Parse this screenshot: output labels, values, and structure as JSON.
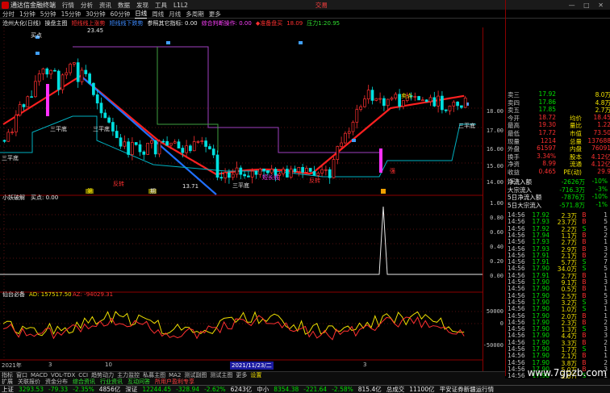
{
  "menubar": {
    "app_title": "通达信金融终端",
    "items": [
      "行情",
      "分析",
      "资讯",
      "数据",
      "发现",
      "工具",
      "L1L2",
      "交易"
    ],
    "brand": "交易"
  },
  "periods": [
    "分时",
    "1分钟",
    "5分钟",
    "15分钟",
    "30分钟",
    "60分钟",
    "日线",
    "周线",
    "月线",
    "多周期",
    "更多"
  ],
  "active_period": "日线",
  "legend": {
    "stock": "沧州大化(日线)",
    "indicator": "操盘主图",
    "up_line": "短线线上涨势",
    "down_line": "短线线下跌势",
    "ref": "参照其它指标: 0.00",
    "plan": "综合判断操作: 0.00",
    "rpt": "◆准备盘买",
    "rpt_val": "18.09",
    "pressure": "压力1:20.95"
  },
  "chart_labels": {
    "high": "23.45",
    "low": "13.71",
    "buy_point": "买点",
    "sell_point": "卖点",
    "three_seller": "三卖点",
    "three_buyer": "三买点",
    "three_point": "三平底",
    "short_long": "短长线",
    "reverse": "反转",
    "strong": "强",
    "a": "第",
    "b": "期"
  },
  "sub1": {
    "name": "小妖破解",
    "label": "买点: 0.00",
    "axis": [
      "1.00",
      "0.80",
      "0.60",
      "0.40",
      "0.20",
      "0.00"
    ]
  },
  "sub2": {
    "name": "仙台必备",
    "ad_label": "AD: 157517.50",
    "az_label": "AZ: -94029.31",
    "axis": [
      "50000",
      "0",
      "-50000"
    ]
  },
  "right_axis": [
    "18.00",
    "17.00",
    "16.00",
    "15.00",
    "14.00"
  ],
  "time_axis": [
    "2021年",
    "3",
    "10",
    "2021/11/23/二",
    "3"
  ],
  "quote_panel": {
    "rows": [
      {
        "k": "卖三",
        "p": "17.92",
        "v": "",
        "x": "8.0万"
      },
      {
        "k": "卖四",
        "p": "17.86",
        "v": "",
        "x": "4.8万"
      },
      {
        "k": "卖五",
        "p": "17.85",
        "v": "",
        "x": "2.7万"
      },
      {
        "k": "今开",
        "p": "18.72",
        "v": "均价",
        "x": "18.45"
      },
      {
        "k": "最高",
        "p": "19.30",
        "v": "量比",
        "x": "1.22"
      },
      {
        "k": "最低",
        "p": "17.72",
        "v": "市值",
        "x": "73.50"
      },
      {
        "k": "现量",
        "p": "1214",
        "v": "总量",
        "x": "137688"
      },
      {
        "k": "外盘",
        "p": "61597",
        "v": "内盘",
        "x": "76091"
      },
      {
        "k": "换手",
        "p": "3.34%",
        "v": "股本",
        "x": "4.12亿"
      },
      {
        "k": "净资",
        "p": "8.99",
        "v": "流通",
        "x": "4.12亿"
      },
      {
        "k": "收益(三)",
        "p": "0.465",
        "v": "PE(动)",
        "x": "29.9"
      }
    ],
    "flow": [
      {
        "k": "净流入额",
        "v": "-2626万",
        "p": "-10%"
      },
      {
        "k": "大宗流入",
        "v": "-716.3万",
        "p": "-3%"
      },
      {
        "k": "5日净流入额",
        "v": "-7876万",
        "p": "-10%"
      },
      {
        "k": "5日大宗流入",
        "v": "-571.8万",
        "p": "-1%"
      }
    ],
    "ticks": [
      {
        "t": "14:56",
        "p": "17.92",
        "v": "2.3万",
        "d": "B",
        "n": "1"
      },
      {
        "t": "14:56",
        "p": "17.93",
        "v": "23.7万",
        "d": "B",
        "n": "5"
      },
      {
        "t": "14:56",
        "p": "17.92",
        "v": "2.2万",
        "d": "S",
        "n": "5"
      },
      {
        "t": "14:56",
        "p": "17.94",
        "v": "1.1万",
        "d": "B",
        "n": "2"
      },
      {
        "t": "14:56",
        "p": "17.93",
        "v": "2.7万",
        "d": "B",
        "n": "1"
      },
      {
        "t": "14:56",
        "p": "17.93",
        "v": "2.9万",
        "d": "B",
        "n": "3"
      },
      {
        "t": "14:56",
        "p": "17.91",
        "v": "2.1万",
        "d": "B",
        "n": "2"
      },
      {
        "t": "14:56",
        "p": "17.91",
        "v": "5.7万",
        "d": "S",
        "n": "7"
      },
      {
        "t": "14:56",
        "p": "17.90",
        "v": "34.0万",
        "d": "S",
        "n": "5"
      },
      {
        "t": "14:56",
        "p": "17.91",
        "v": "2.7万",
        "d": "B",
        "n": "1"
      },
      {
        "t": "14:56",
        "p": "17.90",
        "v": "9.1万",
        "d": "B",
        "n": "3"
      },
      {
        "t": "14:56",
        "p": "17.90",
        "v": "0.5万",
        "d": "B",
        "n": "1"
      },
      {
        "t": "14:56",
        "p": "17.90",
        "v": "2.5万",
        "d": "B",
        "n": "5"
      },
      {
        "t": "14:56",
        "p": "17.90",
        "v": "3.2万",
        "d": "S",
        "n": "3"
      },
      {
        "t": "14:56",
        "p": "17.90",
        "v": "1.0万",
        "d": "S",
        "n": "1"
      },
      {
        "t": "14:56",
        "p": "17.90",
        "v": "2.0万",
        "d": "B",
        "n": "1"
      },
      {
        "t": "14:56",
        "p": "17.90",
        "v": "2.3万",
        "d": "B",
        "n": "2"
      },
      {
        "t": "14:56",
        "p": "17.90",
        "v": "1.3万",
        "d": "S",
        "n": "3"
      },
      {
        "t": "14:56",
        "p": "17.90",
        "v": "4.4万",
        "d": "B",
        "n": "3"
      },
      {
        "t": "14:56",
        "p": "17.90",
        "v": "3.3万",
        "d": "B",
        "n": "2"
      },
      {
        "t": "14:56",
        "p": "17.90",
        "v": "1.7万",
        "d": "S",
        "n": "1"
      },
      {
        "t": "14:56",
        "p": "17.90",
        "v": "2.1万",
        "d": "B",
        "n": "1"
      },
      {
        "t": "14:56",
        "p": "17.90",
        "v": "3.8万",
        "d": "B",
        "n": "2"
      },
      {
        "t": "14:56",
        "p": "17.90",
        "v": "5.0万",
        "d": "B",
        "n": "3"
      },
      {
        "t": "14:56",
        "p": "17.90",
        "v": "2.0万",
        "d": "S",
        "n": "1"
      }
    ]
  },
  "tabs1": [
    "指标",
    "窗口",
    "MACD",
    "VOL-TDX",
    "CCI",
    "趋势动力",
    "主力监控",
    "私募主图",
    "MA2",
    "测试副图",
    "测试主图",
    "更多",
    "设置"
  ],
  "tabs2": [
    "扩展",
    "关联报价",
    "资金分布",
    "综合资讯",
    "行业资讯",
    "互动问答",
    "所用户盈利专享"
  ],
  "status": {
    "sh_name": "上证",
    "sh_val": "3293.53",
    "sh_chg": "-79.33",
    "sh_pct": "-2.35%",
    "sh_amt": "4856亿",
    "sz_name": "深证",
    "sz_val": "12244.45",
    "sz_chg": "-328.94",
    "sz_pct": "-2.62%",
    "sz_amt": "6243亿",
    "zx_name": "中小",
    "zx_val": "8354.38",
    "zx_chg": "-221.64",
    "zx_pct": "-2.58%",
    "zx_amt": "815.4亿",
    "total_label": "总成交",
    "total_val": "11100亿",
    "notice": "平安证券新疆运行情"
  },
  "watermark": "www.7gpzb.com"
}
